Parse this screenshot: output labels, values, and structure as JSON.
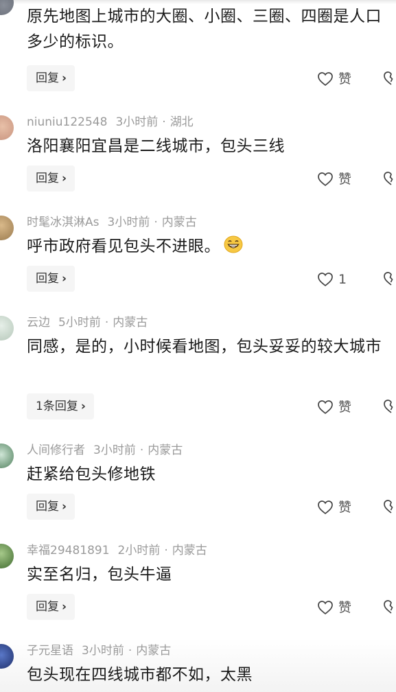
{
  "comments": [
    {
      "text": "原先地图上城市的大圈、小圈、三圈、四圈是人口多少的标识。",
      "reply_label": "回复",
      "like_label": "赞"
    },
    {
      "username": "niuniu122548",
      "time": "3小时前",
      "location": "湖北",
      "text": "洛阳襄阳宜昌是二线城市，包头三线",
      "reply_label": "回复",
      "like_label": "赞"
    },
    {
      "username": "时髦冰淇淋As",
      "time": "3小时前",
      "location": "内蒙古",
      "text": "呼市政府看见包头不进眼。",
      "emoji": "grinning-face",
      "reply_label": "回复",
      "like_label": "1"
    },
    {
      "username": "云边",
      "time": "5小时前",
      "location": "内蒙古",
      "text": "同感，是的，小时候看地图，包头妥妥的较大城市",
      "reply_label": "1条回复",
      "like_label": "赞"
    },
    {
      "username": "人间修行者",
      "time": "3小时前",
      "location": "内蒙古",
      "text": "赶紧给包头修地铁",
      "reply_label": "回复",
      "like_label": "赞"
    },
    {
      "username": "幸福29481891",
      "time": "2小时前",
      "location": "内蒙古",
      "text": "实至名归，包头牛逼",
      "reply_label": "回复",
      "like_label": "赞"
    },
    {
      "username": "子元星语",
      "time": "3小时前",
      "location": "内蒙古",
      "text": "包头现在四线城市都不如，太黑"
    }
  ],
  "separator": "·",
  "chevron": "›",
  "colors": {
    "meta": "#9a9a9a",
    "text": "#1a1a1a",
    "reply_bg": "#f5f5f5"
  },
  "icons": {
    "like": "heart-outline-icon",
    "dislike": "broken-heart-outline-icon"
  }
}
